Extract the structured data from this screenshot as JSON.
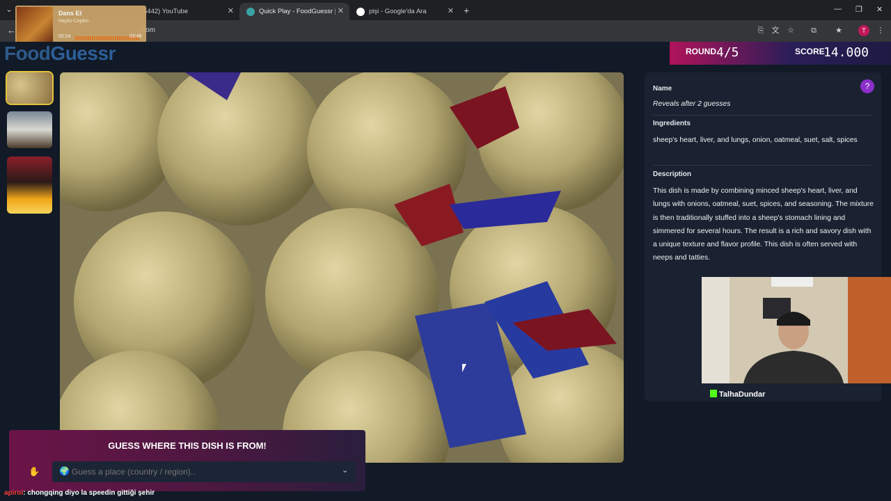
{
  "browser": {
    "tabs": [
      {
        "label": "5442) YouTube",
        "active": false
      },
      {
        "label": "Quick Play - FoodGuessr | Food",
        "active": true
      },
      {
        "label": "pişi - Google'da Ara",
        "active": false
      }
    ],
    "url_fragment": "ndom"
  },
  "music_overlay": {
    "title": "Dans Et",
    "artist": "Hayko Cepkin",
    "elapsed": "02:24",
    "duration": "03:48"
  },
  "logo": {
    "part1": "Food",
    "part2": "Guessr"
  },
  "scoreboard": {
    "round_label": "ROUND",
    "round_value": "4/5",
    "score_label": "SCORE",
    "score_value": "14.000"
  },
  "info_panel": {
    "name_heading": "Name",
    "name_value": "Reveals after 2 guesses",
    "ingredients_heading": "Ingredients",
    "ingredients_value": "sheep's heart, liver, and lungs, onion, oatmeal, suet, salt, spices",
    "description_heading": "Description",
    "description_value": "This dish is made by combining minced sheep's heart, liver, and lungs with onions, oatmeal, suet, spices, and seasoning. The mixture is then traditionally stuffed into a sheep's stomach lining and simmered for several hours. The result is a rich and savory dish with a unique texture and flavor profile. This dish is often served with neeps and tatties."
  },
  "streamer": {
    "name": "TalhaDundar"
  },
  "guess_box": {
    "prompt": "GUESS WHERE THIS DISH IS FROM!",
    "placeholder": "Guess a place (country / region).."
  },
  "chat_line": {
    "user": "apiroi",
    "message": ": chongqing diyo la speedin gittiği şehir"
  }
}
